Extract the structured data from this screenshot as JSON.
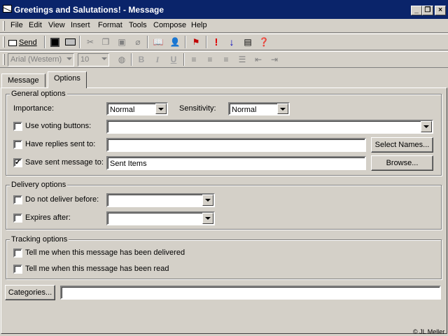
{
  "window": {
    "title": "Greetings and Salutations! - Message",
    "minimize": "_",
    "restore": "❐",
    "close": "×"
  },
  "menu": [
    "File",
    "Edit",
    "View",
    "Insert",
    "Format",
    "Tools",
    "Compose",
    "Help"
  ],
  "toolbar": {
    "send_label": "Send",
    "font_name": "Arial (Western)",
    "font_size": "10",
    "bold": "B",
    "italic": "I",
    "underline": "U"
  },
  "tabs": [
    "Message",
    "Options"
  ],
  "general": {
    "legend": "General options",
    "importance_label": "Importance:",
    "importance_value": "Normal",
    "sensitivity_label": "Sensitivity:",
    "sensitivity_value": "Normal",
    "voting_label": "Use voting buttons:",
    "voting_value": "",
    "replies_label": "Have replies sent to:",
    "replies_value": "",
    "select_names": "Select Names...",
    "save_label": "Save sent message to:",
    "save_value": "Sent Items",
    "save_checked": "✓",
    "browse": "Browse..."
  },
  "delivery": {
    "legend": "Delivery options",
    "not_before_label": "Do not deliver before:",
    "not_before_value": "",
    "expires_label": "Expires after:",
    "expires_value": ""
  },
  "tracking": {
    "legend": "Tracking options",
    "delivered_label": "Tell me when this message has been delivered",
    "read_label": "Tell me when this message has been read"
  },
  "categories": {
    "button": "Categories...",
    "value": ""
  },
  "copyright": "© JL Meller"
}
